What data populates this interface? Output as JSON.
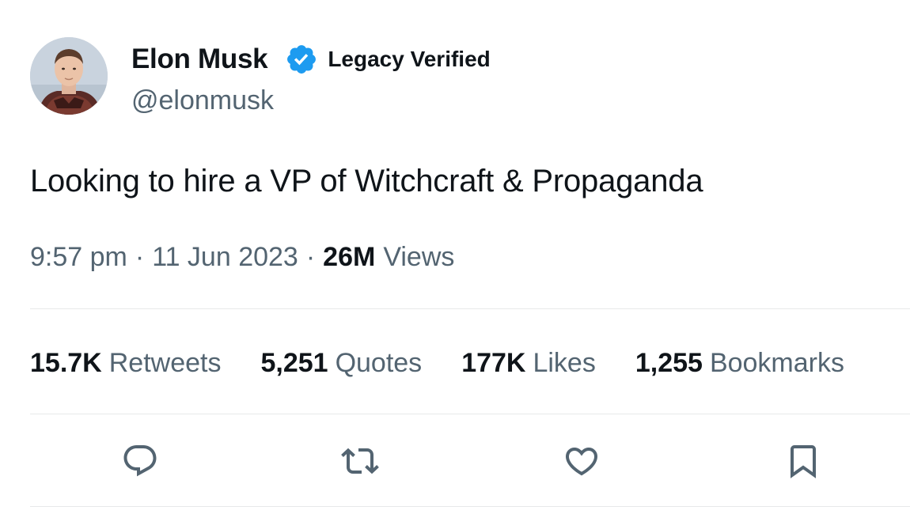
{
  "author": {
    "display_name": "Elon Musk",
    "verified_label": "Legacy Verified",
    "handle": "@elonmusk",
    "avatar_icon": "profile-photo",
    "verified_color": "#1d9bf0"
  },
  "tweet": {
    "text": "Looking to hire a VP of Witchcraft & Propaganda"
  },
  "meta": {
    "time": "9:57 pm",
    "separator": "·",
    "date": "11 Jun 2023",
    "views_count": "26M",
    "views_label": "Views"
  },
  "stats": [
    {
      "count": "15.7K",
      "label": "Retweets"
    },
    {
      "count": "5,251",
      "label": "Quotes"
    },
    {
      "count": "177K",
      "label": "Likes"
    },
    {
      "count": "1,255",
      "label": "Bookmarks"
    }
  ],
  "actions": {
    "reply_icon": "speech-bubble-icon",
    "retweet_icon": "retweet-arrows-icon",
    "like_icon": "heart-icon",
    "bookmark_icon": "bookmark-icon"
  },
  "colors": {
    "text_primary": "#0f1419",
    "text_secondary": "#536471",
    "divider": "#e7e9ea"
  }
}
